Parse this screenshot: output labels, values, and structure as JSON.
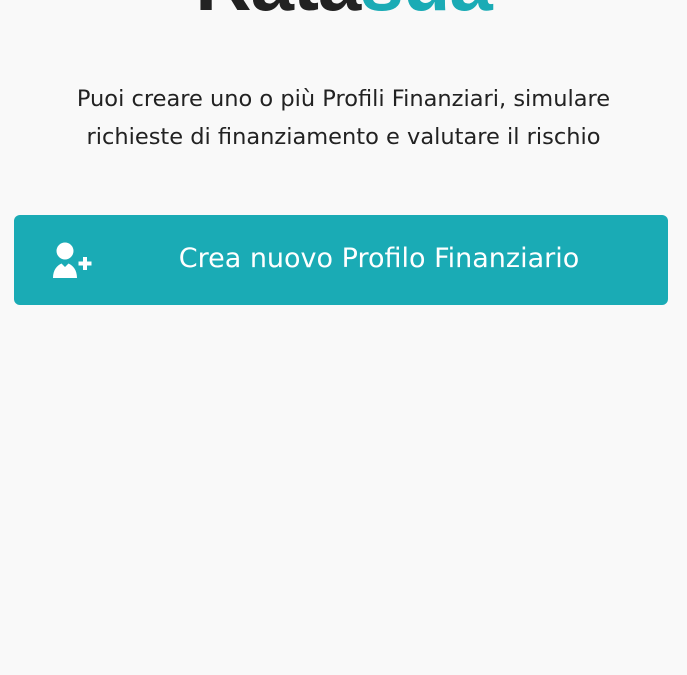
{
  "logo": {
    "part_a": "Rata",
    "part_b": "sua"
  },
  "intro": {
    "line1": "Puoi creare uno o più Profili Finanziari, simulare",
    "line2": "richieste di finanziamento e valutare il rischio"
  },
  "cta": {
    "label": "Crea nuovo Profilo Finanziario",
    "icon": "add-user-icon"
  },
  "colors": {
    "accent": "#1aabb5",
    "text": "#222222",
    "background": "#f9f9f9"
  }
}
